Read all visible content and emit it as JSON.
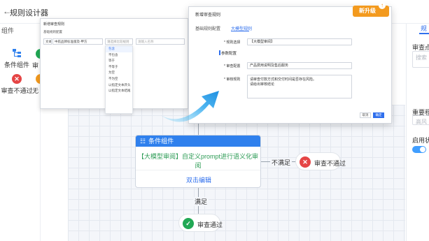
{
  "header": {
    "back_icon": "arrow-left-icon",
    "title": "规则设计器"
  },
  "left_panel": {
    "title": "组件",
    "items": [
      {
        "label": "条件组件",
        "icon": "tree-icon"
      },
      {
        "label": "审查不通过",
        "icon": "close-circle-icon"
      }
    ],
    "partial_labels": [
      "审",
      "无"
    ],
    "partial_label_3": "手"
  },
  "right_panel": {
    "tab": "规",
    "field_1_label": "审查点名",
    "field_1_placeholder": "搜索",
    "field_2_label": "重要程度",
    "field_2_placeholder": "高风",
    "field_3_label": "启用状"
  },
  "flow": {
    "condition_node": {
      "title": "条件组件",
      "body": "【大模型审阅】自定义prompt进行语义化审阅",
      "edit": "双击编辑"
    },
    "not_satisfied_label": "不满足",
    "satisfied_label": "满足",
    "fail_result": "审查不通过",
    "pass_result": "审查通过"
  },
  "bg_screenshot": {
    "title": "新增审查规则",
    "subtitle": "基础规则配置",
    "field_a_label": "文本",
    "field_a_value": "中航品牌标准版及-甲方",
    "field_b_value": "请选择比较规则",
    "field_c_placeholder": "请输入名称",
    "options": [
      "包含",
      "不包含",
      "等于",
      "不等于",
      "为空",
      "不为空",
      "以指定文本开头",
      "以指定文本结尾"
    ],
    "selected_index": 0
  },
  "fg_dialog": {
    "title": "新增审查规则",
    "tabs": [
      "基础规则配置",
      "大模型规则"
    ],
    "active_tab": 1,
    "rule_label": "* 规则选择",
    "rule_value": "【大模型审阅】",
    "section": "参数配置",
    "audit_config_label": "* 审查配置",
    "audit_config_value": "产品费用说明及售后服务",
    "audit_rule_label": "* 审核规则",
    "audit_rule_text_1": "请审查付款方式和交付时间是否存在风险。",
    "audit_rule_text_2": "请给出审核结论",
    "cancel": "取消",
    "confirm": "确定"
  },
  "badge": {
    "label": "新升级"
  },
  "colors": {
    "primary": "#2f6fed",
    "danger": "#e54545",
    "success": "#21a854",
    "badge": "#f39a1e"
  }
}
